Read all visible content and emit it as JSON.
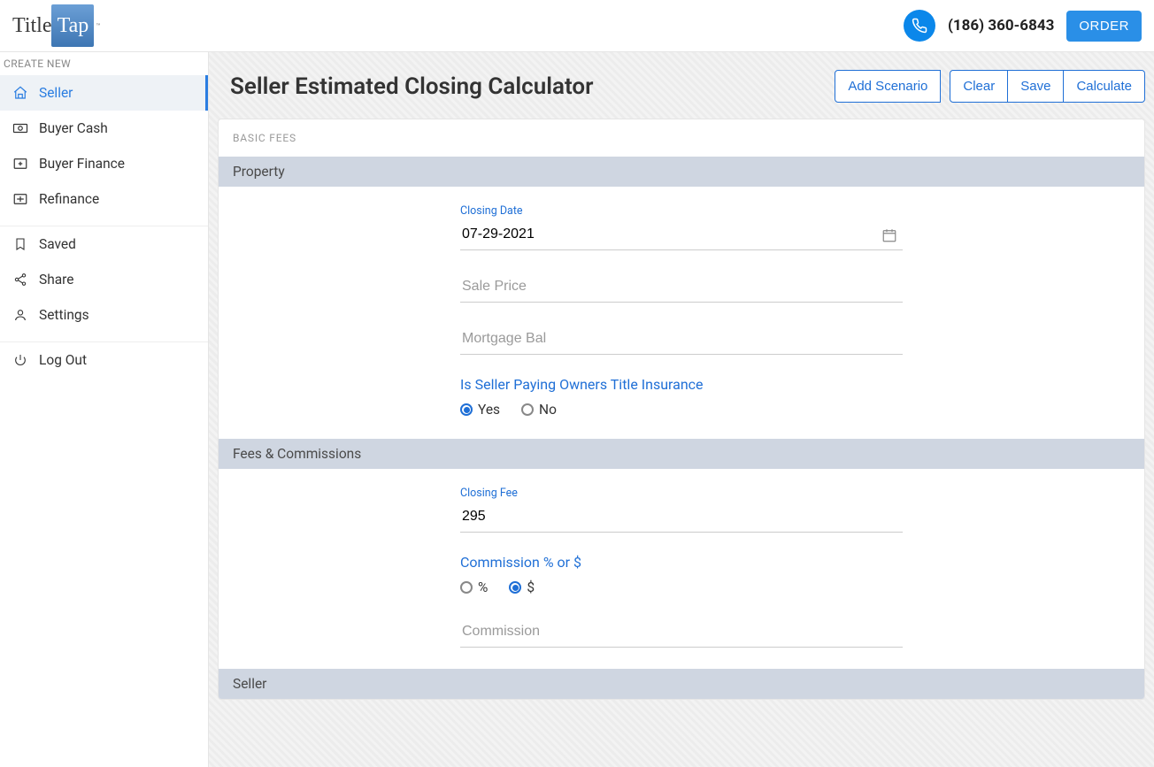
{
  "header": {
    "logo_part1": "Title",
    "logo_part2": "Tap",
    "logo_tm": "™",
    "phone": "(186) 360-6843",
    "order_label": "ORDER"
  },
  "sidebar": {
    "heading": "CREATE NEW",
    "items": [
      {
        "label": "Seller"
      },
      {
        "label": "Buyer Cash"
      },
      {
        "label": "Buyer Finance"
      },
      {
        "label": "Refinance"
      }
    ],
    "secondary": [
      {
        "label": "Saved"
      },
      {
        "label": "Share"
      },
      {
        "label": "Settings"
      }
    ],
    "logout": {
      "label": "Log Out"
    }
  },
  "page": {
    "title": "Seller Estimated Closing Calculator",
    "actions": {
      "add_scenario": "Add Scenario",
      "clear": "Clear",
      "save": "Save",
      "calculate": "Calculate"
    },
    "basic_fees_label": "BASIC FEES",
    "sections": {
      "property": {
        "heading": "Property",
        "closing_date": {
          "label": "Closing Date",
          "value": "07-29-2021"
        },
        "sale_price": {
          "placeholder": "Sale Price",
          "value": ""
        },
        "mortgage_bal": {
          "placeholder": "Mortgage Bal",
          "value": ""
        },
        "title_ins": {
          "question": "Is Seller Paying Owners Title Insurance",
          "yes": "Yes",
          "no": "No",
          "selected": "Yes"
        }
      },
      "fees": {
        "heading": "Fees & Commissions",
        "closing_fee": {
          "label": "Closing Fee",
          "value": "295"
        },
        "commission_type": {
          "question": "Commission % or $",
          "pct": "%",
          "dollar": "$",
          "selected": "$"
        },
        "commission": {
          "placeholder": "Commission",
          "value": ""
        }
      },
      "seller": {
        "heading": "Seller"
      }
    }
  }
}
